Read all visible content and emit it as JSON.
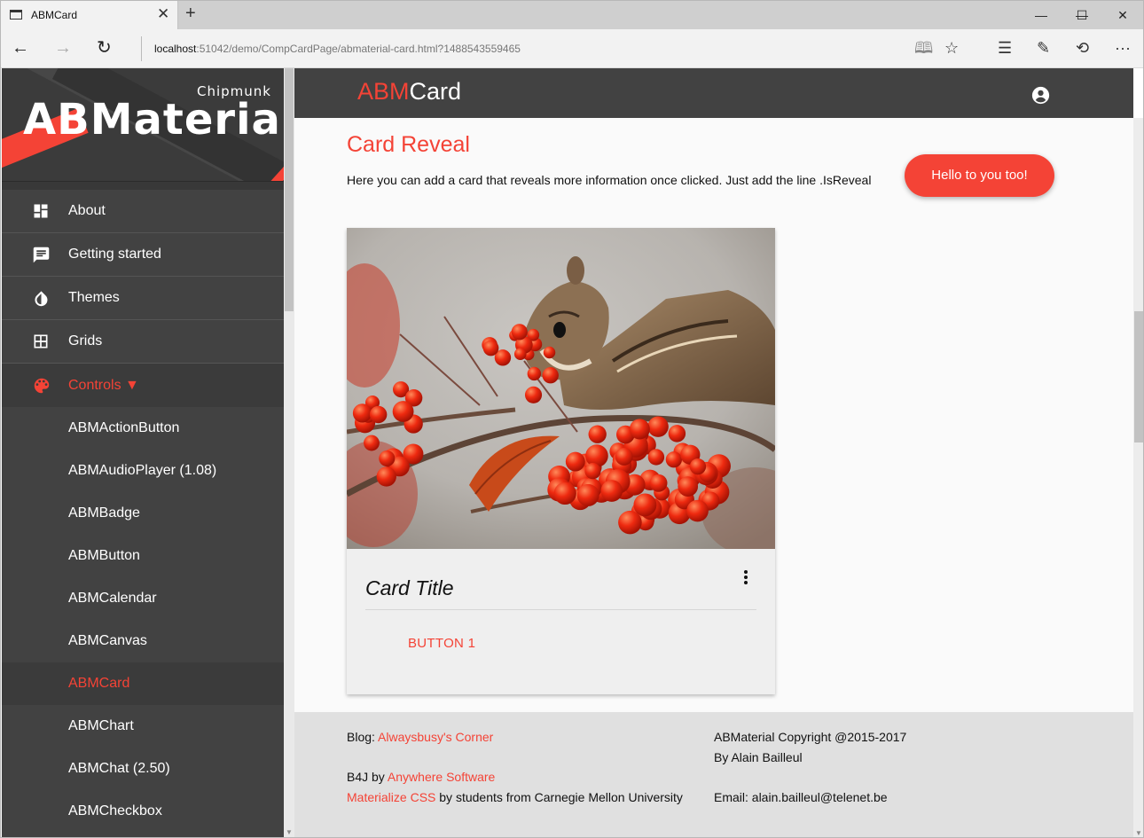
{
  "browser": {
    "tab_title": "ABMCard",
    "close_glyph": "✕",
    "new_tab_glyph": "+",
    "window_controls": [
      "—",
      "☐",
      "✕"
    ],
    "url_host": "localhost",
    "url_path": ":51042/demo/CompCardPage/abmaterial-card.html?1488543559465",
    "nav_glyphs": {
      "back": "←",
      "forward": "→",
      "refresh": "↻"
    },
    "toolbar_glyphs": {
      "reading": "🕮",
      "favorite": "☆",
      "hub": "☰",
      "note": "✎",
      "share": "⟲",
      "more": "···"
    }
  },
  "sidebar": {
    "logo_small": "Chipmunk",
    "logo_big": "ABMaterial",
    "menu": [
      {
        "label": "About",
        "icon": "dashboard-icon"
      },
      {
        "label": "Getting started",
        "icon": "chat-icon"
      },
      {
        "label": "Themes",
        "icon": "invert-colors-icon"
      },
      {
        "label": "Grids",
        "icon": "grid-icon"
      },
      {
        "label": "Controls ▼",
        "icon": "palette-icon",
        "active": true
      }
    ],
    "submenu": [
      "ABMActionButton",
      "ABMAudioPlayer (1.08)",
      "ABMBadge",
      "ABMButton",
      "ABMCalendar",
      "ABMCanvas",
      "ABMCard",
      "ABMChart",
      "ABMChat (2.50)",
      "ABMCheckbox"
    ],
    "submenu_active": "ABMCard"
  },
  "header": {
    "title_accent": "ABM",
    "title_rest": "Card",
    "account_icon": "account-circle-icon"
  },
  "content": {
    "section_title": "Card Reveal",
    "description": "Here you can add a card that reveals more information once clicked. Just add the line .IsReveal",
    "toast": "Hello to you too!",
    "card": {
      "image_alt": "Chipmunk eating red rowan berries",
      "title": "Card Title",
      "button": "BUTTON 1"
    }
  },
  "footer": {
    "blog_label": "Blog: ",
    "blog_link": "Alwaysbusy's Corner",
    "b4j_label": "B4J by ",
    "b4j_link": "Anywhere Software",
    "materialize_link": "Materialize CSS",
    "materialize_rest": " by students from Carnegie Mellon University",
    "copyright": "ABMaterial Copyright @2015-2017",
    "author": "By Alain Bailleul",
    "email": "Email: alain.bailleul@telenet.be"
  },
  "colors": {
    "accent": "#f44336",
    "dark": "#424242",
    "content_bg": "#fafafa",
    "footer_bg": "#e0e0e0"
  }
}
